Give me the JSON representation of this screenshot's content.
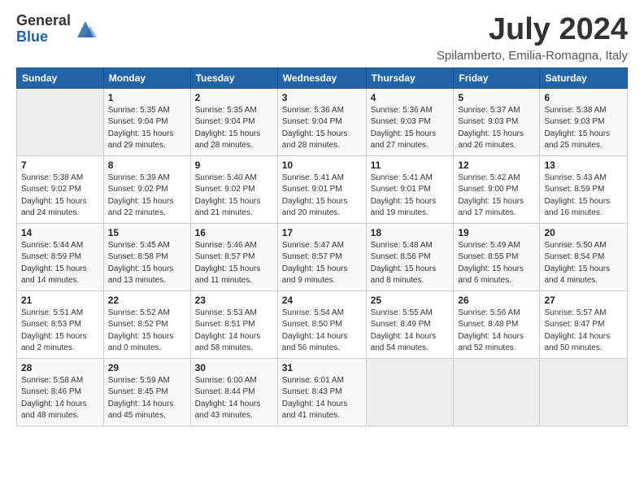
{
  "header": {
    "logo_general": "General",
    "logo_blue": "Blue",
    "month": "July 2024",
    "location": "Spilamberto, Emilia-Romagna, Italy"
  },
  "weekdays": [
    "Sunday",
    "Monday",
    "Tuesday",
    "Wednesday",
    "Thursday",
    "Friday",
    "Saturday"
  ],
  "weeks": [
    [
      {
        "day": "",
        "detail": ""
      },
      {
        "day": "1",
        "detail": "Sunrise: 5:35 AM\nSunset: 9:04 PM\nDaylight: 15 hours\nand 29 minutes."
      },
      {
        "day": "2",
        "detail": "Sunrise: 5:35 AM\nSunset: 9:04 PM\nDaylight: 15 hours\nand 28 minutes."
      },
      {
        "day": "3",
        "detail": "Sunrise: 5:36 AM\nSunset: 9:04 PM\nDaylight: 15 hours\nand 28 minutes."
      },
      {
        "day": "4",
        "detail": "Sunrise: 5:36 AM\nSunset: 9:03 PM\nDaylight: 15 hours\nand 27 minutes."
      },
      {
        "day": "5",
        "detail": "Sunrise: 5:37 AM\nSunset: 9:03 PM\nDaylight: 15 hours\nand 26 minutes."
      },
      {
        "day": "6",
        "detail": "Sunrise: 5:38 AM\nSunset: 9:03 PM\nDaylight: 15 hours\nand 25 minutes."
      }
    ],
    [
      {
        "day": "7",
        "detail": "Sunrise: 5:38 AM\nSunset: 9:02 PM\nDaylight: 15 hours\nand 24 minutes."
      },
      {
        "day": "8",
        "detail": "Sunrise: 5:39 AM\nSunset: 9:02 PM\nDaylight: 15 hours\nand 22 minutes."
      },
      {
        "day": "9",
        "detail": "Sunrise: 5:40 AM\nSunset: 9:02 PM\nDaylight: 15 hours\nand 21 minutes."
      },
      {
        "day": "10",
        "detail": "Sunrise: 5:41 AM\nSunset: 9:01 PM\nDaylight: 15 hours\nand 20 minutes."
      },
      {
        "day": "11",
        "detail": "Sunrise: 5:41 AM\nSunset: 9:01 PM\nDaylight: 15 hours\nand 19 minutes."
      },
      {
        "day": "12",
        "detail": "Sunrise: 5:42 AM\nSunset: 9:00 PM\nDaylight: 15 hours\nand 17 minutes."
      },
      {
        "day": "13",
        "detail": "Sunrise: 5:43 AM\nSunset: 8:59 PM\nDaylight: 15 hours\nand 16 minutes."
      }
    ],
    [
      {
        "day": "14",
        "detail": "Sunrise: 5:44 AM\nSunset: 8:59 PM\nDaylight: 15 hours\nand 14 minutes."
      },
      {
        "day": "15",
        "detail": "Sunrise: 5:45 AM\nSunset: 8:58 PM\nDaylight: 15 hours\nand 13 minutes."
      },
      {
        "day": "16",
        "detail": "Sunrise: 5:46 AM\nSunset: 8:57 PM\nDaylight: 15 hours\nand 11 minutes."
      },
      {
        "day": "17",
        "detail": "Sunrise: 5:47 AM\nSunset: 8:57 PM\nDaylight: 15 hours\nand 9 minutes."
      },
      {
        "day": "18",
        "detail": "Sunrise: 5:48 AM\nSunset: 8:56 PM\nDaylight: 15 hours\nand 8 minutes."
      },
      {
        "day": "19",
        "detail": "Sunrise: 5:49 AM\nSunset: 8:55 PM\nDaylight: 15 hours\nand 6 minutes."
      },
      {
        "day": "20",
        "detail": "Sunrise: 5:50 AM\nSunset: 8:54 PM\nDaylight: 15 hours\nand 4 minutes."
      }
    ],
    [
      {
        "day": "21",
        "detail": "Sunrise: 5:51 AM\nSunset: 8:53 PM\nDaylight: 15 hours\nand 2 minutes."
      },
      {
        "day": "22",
        "detail": "Sunrise: 5:52 AM\nSunset: 8:52 PM\nDaylight: 15 hours\nand 0 minutes."
      },
      {
        "day": "23",
        "detail": "Sunrise: 5:53 AM\nSunset: 8:51 PM\nDaylight: 14 hours\nand 58 minutes."
      },
      {
        "day": "24",
        "detail": "Sunrise: 5:54 AM\nSunset: 8:50 PM\nDaylight: 14 hours\nand 56 minutes."
      },
      {
        "day": "25",
        "detail": "Sunrise: 5:55 AM\nSunset: 8:49 PM\nDaylight: 14 hours\nand 54 minutes."
      },
      {
        "day": "26",
        "detail": "Sunrise: 5:56 AM\nSunset: 8:48 PM\nDaylight: 14 hours\nand 52 minutes."
      },
      {
        "day": "27",
        "detail": "Sunrise: 5:57 AM\nSunset: 8:47 PM\nDaylight: 14 hours\nand 50 minutes."
      }
    ],
    [
      {
        "day": "28",
        "detail": "Sunrise: 5:58 AM\nSunset: 8:46 PM\nDaylight: 14 hours\nand 48 minutes."
      },
      {
        "day": "29",
        "detail": "Sunrise: 5:59 AM\nSunset: 8:45 PM\nDaylight: 14 hours\nand 45 minutes."
      },
      {
        "day": "30",
        "detail": "Sunrise: 6:00 AM\nSunset: 8:44 PM\nDaylight: 14 hours\nand 43 minutes."
      },
      {
        "day": "31",
        "detail": "Sunrise: 6:01 AM\nSunset: 8:43 PM\nDaylight: 14 hours\nand 41 minutes."
      },
      {
        "day": "",
        "detail": ""
      },
      {
        "day": "",
        "detail": ""
      },
      {
        "day": "",
        "detail": ""
      }
    ]
  ]
}
